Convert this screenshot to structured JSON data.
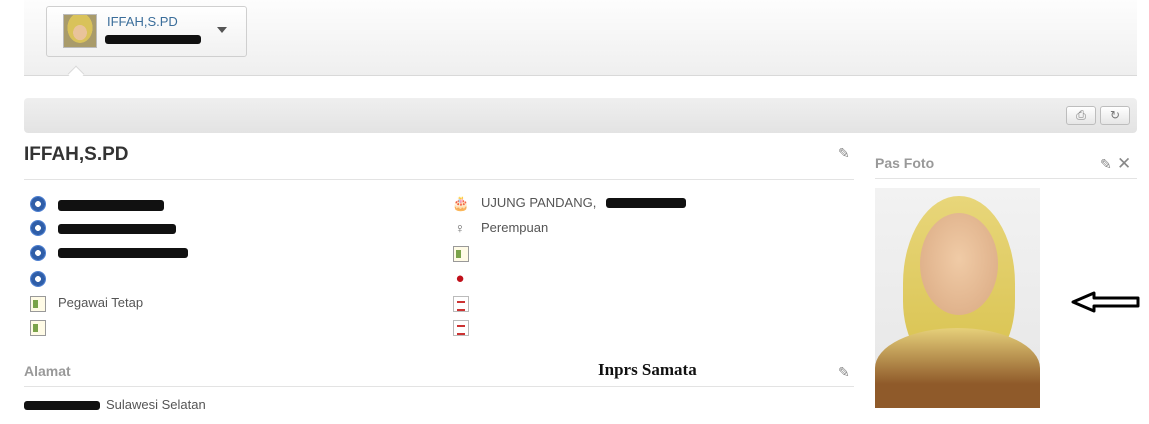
{
  "user_menu": {
    "name": "IFFAH,S.PD",
    "avatar_icon": "user-avatar"
  },
  "toolbar": {
    "print_icon": "printer-icon",
    "refresh_icon": "refresh-icon"
  },
  "profile": {
    "name": "IFFAH,S.PD",
    "left_fields": [
      {
        "icon": "emblem-icon",
        "value": ""
      },
      {
        "icon": "emblem-icon",
        "value": ""
      },
      {
        "icon": "emblem-icon",
        "value": ""
      },
      {
        "icon": "emblem-icon",
        "value": ""
      },
      {
        "icon": "id-card-icon",
        "value": "Pegawai Tetap"
      },
      {
        "icon": "id-card-icon",
        "value": ""
      }
    ],
    "right_fields": [
      {
        "icon": "birthday-cake-icon",
        "value": "UJUNG PANDANG,"
      },
      {
        "icon": "gender-female-icon",
        "value": "Perempuan"
      },
      {
        "icon": "id-card-icon",
        "value": ""
      },
      {
        "icon": "blood-drop-icon",
        "value": ""
      },
      {
        "icon": "flag-icon",
        "value": ""
      },
      {
        "icon": "document-icon",
        "value": ""
      }
    ]
  },
  "address": {
    "title": "Alamat",
    "value": "Sulawesi Selatan"
  },
  "annotation": "Inprs Samata",
  "photo_panel": {
    "title": "Pas Foto"
  }
}
